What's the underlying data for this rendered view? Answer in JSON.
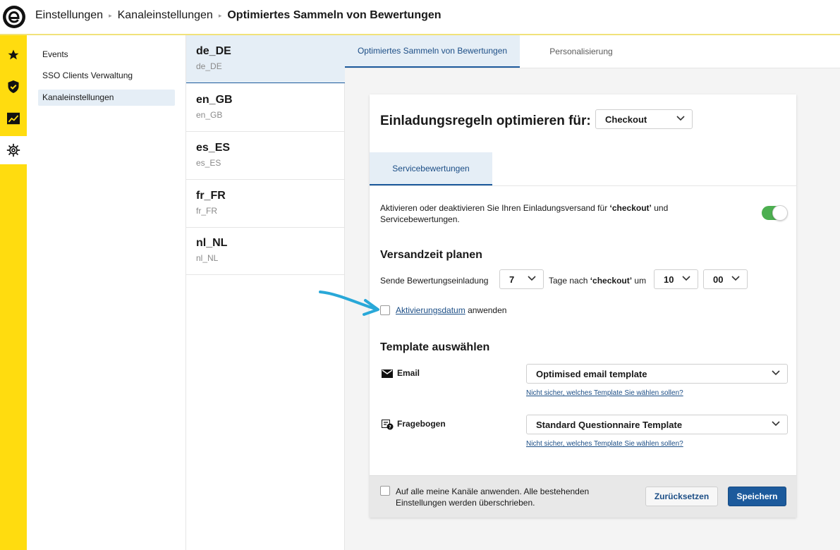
{
  "breadcrumb": {
    "items": [
      "Einstellungen",
      "Kanaleinstellungen"
    ],
    "current": "Optimiertes Sammeln von Bewertungen",
    "separator": "▸"
  },
  "rail": {
    "items": [
      {
        "icon": "star-icon"
      },
      {
        "icon": "shield-check-icon"
      },
      {
        "icon": "analytics-chart-icon"
      },
      {
        "icon": "gear-icon",
        "active": true
      }
    ],
    "color": "#ffdc0f"
  },
  "subnav": {
    "items": [
      "Events",
      "SSO Clients Verwaltung",
      "Kanaleinstellungen"
    ],
    "active": "Kanaleinstellungen"
  },
  "locales": [
    {
      "code": "de_DE",
      "sub": "de_DE",
      "active": true
    },
    {
      "code": "en_GB",
      "sub": "en_GB"
    },
    {
      "code": "es_ES",
      "sub": "es_ES"
    },
    {
      "code": "fr_FR",
      "sub": "fr_FR"
    },
    {
      "code": "nl_NL",
      "sub": "nl_NL"
    }
  ],
  "tabs": [
    "Optimiertes Sammeln von Bewertungen",
    "Personalisierung"
  ],
  "card": {
    "title": "Einladungsregeln optimieren für:",
    "trigger_select": "Checkout",
    "subtab": "Servicebewertungen",
    "desc_pre": "Aktivieren oder deaktivieren Sie Ihren Einladungsversand für ",
    "desc_bold": "‘checkout’",
    "desc_post": " und Servicebewertungen.",
    "toggle_on": true,
    "schedule_heading": "Versandzeit planen",
    "send_label": "Sende Bewertungseinladung",
    "days_value": "7",
    "days_after_pre": "Tage nach ",
    "days_after_bold": "‘checkout’",
    "days_after_post": " um",
    "hour_value": "10",
    "minute_value": "00",
    "activation_link": "Aktivierungsdatum",
    "activation_suffix": "anwenden",
    "template_heading": "Template auswählen",
    "email_label": "Email",
    "email_template": "Optimised email template",
    "questionnaire_label": "Fragebogen",
    "questionnaire_template": "Standard Questionnaire Template",
    "help_link": "Nicht sicher, welches Template Sie wählen sollen?",
    "apply_all_label": "Auf alle meine Kanäle anwenden. Alle bestehenden Einstellungen werden überschrieben.",
    "reset_label": "Zurücksetzen",
    "save_label": "Speichern"
  },
  "colors": {
    "accent": "#1c5a9c",
    "active_bg": "#e5eef6",
    "toggle_on": "#4caf50",
    "annotation_arrow": "#29a8d8"
  }
}
